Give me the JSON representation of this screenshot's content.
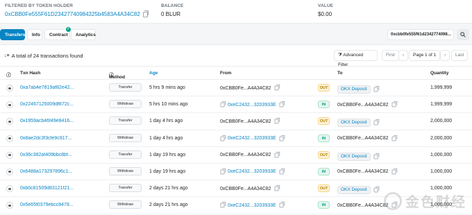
{
  "header": {
    "holder_label": "FILTERED BY TOKEN HOLDER",
    "holder_address": "0xCBB0Fe555F61D23427740984325b4583A4A34C82",
    "balance_label": "BALANCE",
    "balance_value": "0 BLUR",
    "value_label": "VALUE",
    "value_value": "$0.00"
  },
  "tabs": [
    {
      "label": "Transfers"
    },
    {
      "label": "Info"
    },
    {
      "label": "Contract",
      "badge": "✓"
    },
    {
      "label": "Analytics"
    }
  ],
  "search": {
    "address": "0xcbb0fe555f61d2342774098..."
  },
  "summary": "A total of 24 transactions found",
  "controls": {
    "advanced_filter": "Advanced Filter",
    "first": "First",
    "page": "Page 1 of 1",
    "last": "Last"
  },
  "columns": {
    "hash": "Txn Hash",
    "method": "Method",
    "age": "Age",
    "from": "From",
    "to": "To",
    "quantity": "Quantity"
  },
  "rows": [
    {
      "hash": "0xa7ab4e7819af82e42...",
      "method": "Transfer",
      "age": "5 hrs 9 mins ago",
      "from": "0xCBB0Fe...A4A34C82",
      "dir": "OUT",
      "to": "OKX Deposit",
      "qty": "1,999,999"
    },
    {
      "hash": "0x22467125009df872c...",
      "method": "Withdraw",
      "age": "5 hrs 10 mins ago",
      "from": "0xeC2432...3203933E",
      "dir": "IN",
      "to": "0xCBB0Fe...A4A34C82",
      "qty": "1,999,999"
    },
    {
      "hash": "0x1959acb46f49e8416...",
      "method": "Transfer",
      "age": "1 day 4 hrs ago",
      "from": "0xCBB0Fe...A4A34C82",
      "dir": "OUT",
      "to": "OKX Deposit",
      "qty": "2,000,000"
    },
    {
      "hash": "0x8ae2dc3f3cfe9c917...",
      "method": "Withdraw",
      "age": "1 day 4 hrs ago",
      "from": "0xeC2432...3203933E",
      "dir": "IN",
      "to": "0xCBB0Fe...A4A34C82",
      "qty": "2,000,000"
    },
    {
      "hash": "0x36c382af409bbc8bf...",
      "method": "Transfer",
      "age": "1 day 19 hrs ago",
      "from": "0xCBB0Fe...A4A34C82",
      "dir": "OUT",
      "to": "OKX Deposit",
      "qty": "1,000,000"
    },
    {
      "hash": "0x6488a173297896c1...",
      "method": "Withdraw",
      "age": "1 day 19 hrs ago",
      "from": "0xeC2432...3203933E",
      "dir": "IN",
      "to": "0xCBB0Fe...A4A34C82",
      "qty": "1,000,000"
    },
    {
      "hash": "0xb0c81509d83121f21...",
      "method": "Transfer",
      "age": "2 days 21 hrs ago",
      "from": "0xCBB0Fe...A4A34C82",
      "dir": "OUT",
      "to": "OKX Deposit",
      "qty": "1,000,000"
    },
    {
      "hash": "0x5e65f0379ebcc8478...",
      "method": "Withdraw",
      "age": "2 days 21 hrs ago",
      "from": "0xeC2432...3203933E",
      "dir": "IN",
      "to": "0xCBB0Fe...A4A34C82",
      "qty": "1,000,000"
    }
  ],
  "watermark": "金色财经"
}
